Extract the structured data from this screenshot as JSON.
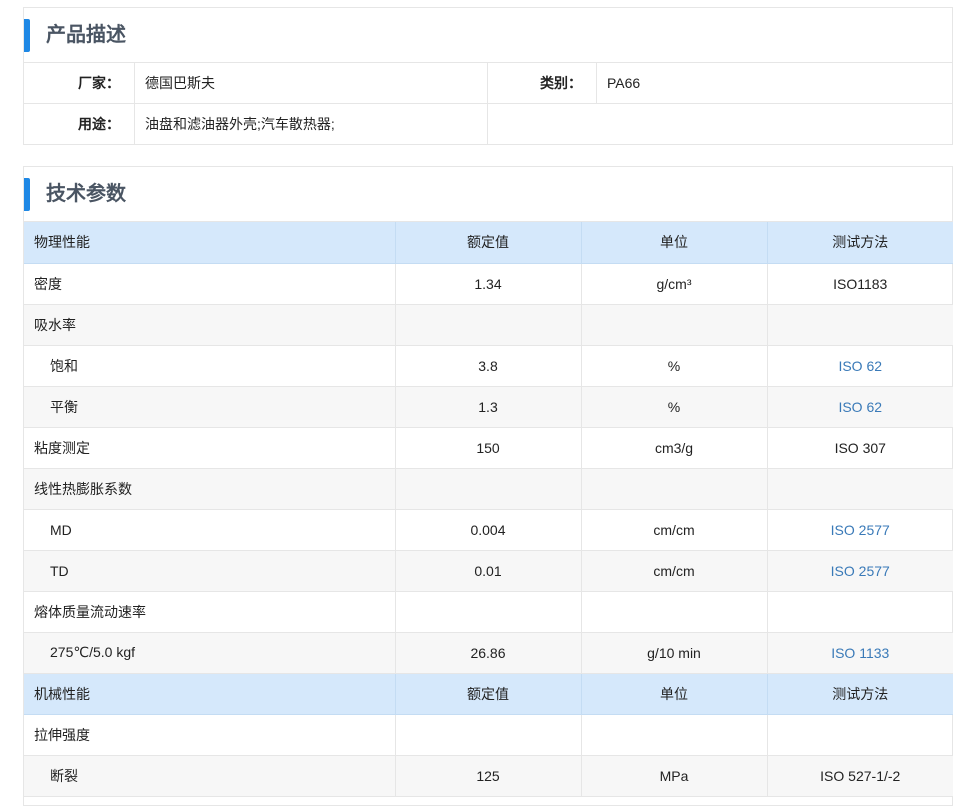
{
  "description": {
    "title": "产品描述",
    "manufacturer_label": "厂家：",
    "manufacturer": "德国巴斯夫",
    "category_label": "类别：",
    "category": "PA66",
    "usage_label": "用途：",
    "usage": "油盘和滤油器外壳;汽车散热器;"
  },
  "tech": {
    "title": "技术参数",
    "sections": [
      {
        "header": [
          "物理性能",
          "额定值",
          "单位",
          "测试方法"
        ],
        "rows": [
          {
            "name": "密度",
            "value": "1.34",
            "unit": "g/cm³",
            "method": "ISO1183",
            "link": false,
            "sub": false
          },
          {
            "name": "吸水率",
            "value": "",
            "unit": "",
            "method": "",
            "link": false,
            "sub": false
          },
          {
            "name": "饱和",
            "value": "3.8",
            "unit": "%",
            "method": "ISO 62",
            "link": true,
            "sub": true
          },
          {
            "name": "平衡",
            "value": "1.3",
            "unit": "%",
            "method": "ISO 62",
            "link": true,
            "sub": true
          },
          {
            "name": "粘度测定",
            "value": "150",
            "unit": "cm3/g",
            "method": "ISO 307",
            "link": false,
            "sub": false
          },
          {
            "name": "线性热膨胀系数",
            "value": "",
            "unit": "",
            "method": "",
            "link": false,
            "sub": false
          },
          {
            "name": "MD",
            "value": "0.004",
            "unit": "cm/cm",
            "method": "ISO 2577",
            "link": true,
            "sub": true
          },
          {
            "name": "TD",
            "value": "0.01",
            "unit": "cm/cm",
            "method": "ISO 2577",
            "link": true,
            "sub": true
          },
          {
            "name": "熔体质量流动速率",
            "value": "",
            "unit": "",
            "method": "",
            "link": false,
            "sub": false
          },
          {
            "name": "275℃/5.0 kgf",
            "value": "26.86",
            "unit": "g/10 min",
            "method": "ISO 1133",
            "link": true,
            "sub": true
          }
        ]
      },
      {
        "header": [
          "机械性能",
          "额定值",
          "单位",
          "测试方法"
        ],
        "rows": [
          {
            "name": "拉伸强度",
            "value": "",
            "unit": "",
            "method": "",
            "link": false,
            "sub": false
          },
          {
            "name": "断裂",
            "value": "125",
            "unit": "MPa",
            "method": "ISO 527-1/-2",
            "link": false,
            "sub": true
          }
        ]
      }
    ]
  }
}
